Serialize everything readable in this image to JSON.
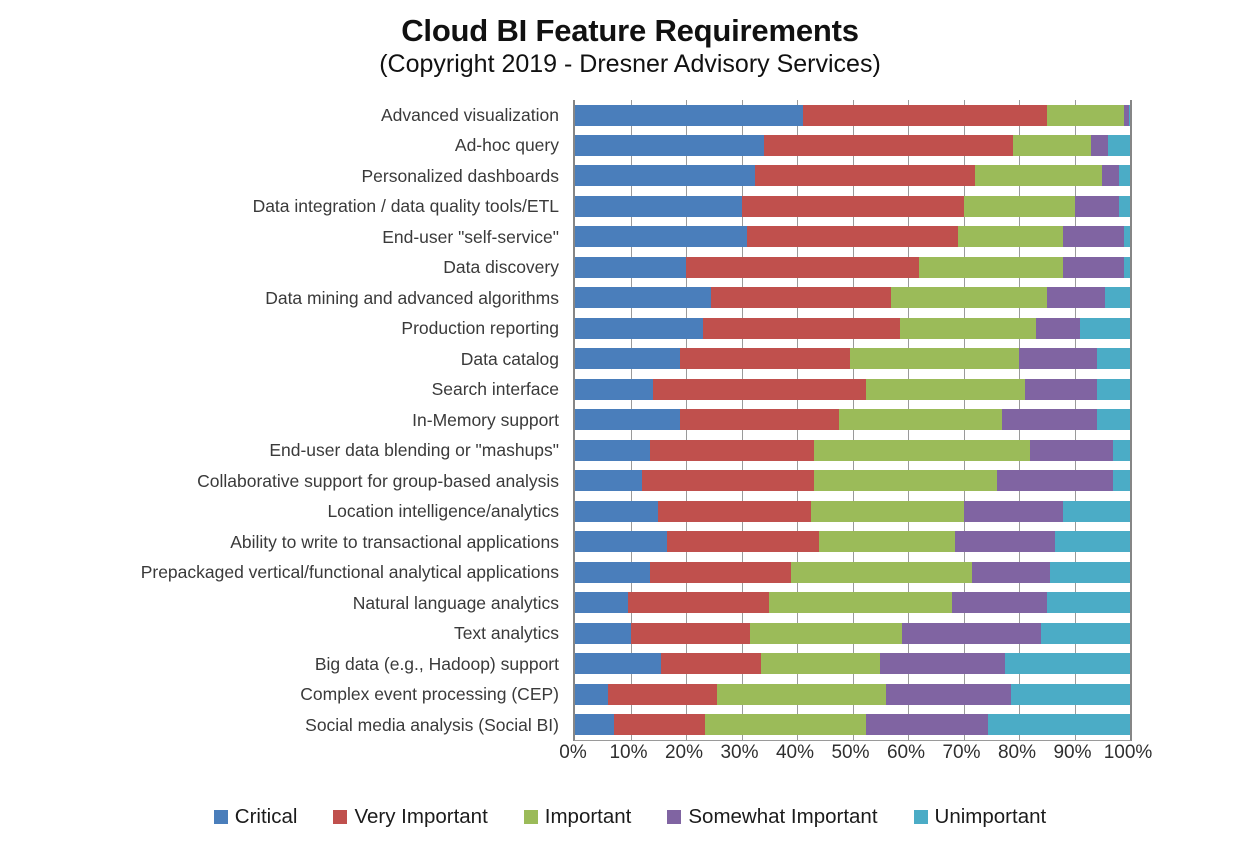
{
  "header": {
    "title": "Cloud BI Feature Requirements",
    "subtitle": "(Copyright 2019 - Dresner Advisory Services)"
  },
  "chart_data": {
    "type": "bar",
    "orientation": "horizontal",
    "stacked": true,
    "stack_mode": "percent",
    "title": "Cloud BI Feature Requirements",
    "subtitle": "(Copyright 2019 - Dresner Advisory Services)",
    "xlabel": "",
    "ylabel": "",
    "xlim": [
      0,
      100
    ],
    "xticks": [
      "0%",
      "10%",
      "20%",
      "30%",
      "40%",
      "50%",
      "60%",
      "70%",
      "80%",
      "90%",
      "100%"
    ],
    "xtick_values": [
      0,
      10,
      20,
      30,
      40,
      50,
      60,
      70,
      80,
      90,
      100
    ],
    "grid": true,
    "grid_axis": "x",
    "legend_position": "bottom",
    "categories": [
      "Advanced visualization",
      "Ad-hoc query",
      "Personalized dashboards",
      "Data integration / data quality tools/ETL",
      "End-user \"self-service\"",
      "Data discovery",
      "Data mining and advanced algorithms",
      "Production reporting",
      "Data catalog",
      "Search interface",
      "In-Memory support",
      "End-user data blending or \"mashups\"",
      "Collaborative support for group-based analysis",
      "Location intelligence/analytics",
      "Ability to write to transactional applications",
      "Prepackaged vertical/functional analytical applications",
      "Natural language analytics",
      "Text analytics",
      "Big data (e.g., Hadoop) support",
      "Complex event processing (CEP)",
      "Social media analysis (Social BI)"
    ],
    "series": [
      {
        "name": "Critical",
        "color": "#4A7EBB",
        "values": [
          41.0,
          34.0,
          32.5,
          30.0,
          31.0,
          20.0,
          24.5,
          23.0,
          19.0,
          14.0,
          19.0,
          13.5,
          12.0,
          15.0,
          16.5,
          13.5,
          9.5,
          10.0,
          15.5,
          6.0,
          7.0
        ]
      },
      {
        "name": "Very Important",
        "color": "#C0504D",
        "values": [
          44.0,
          45.0,
          39.5,
          40.0,
          38.0,
          42.0,
          32.5,
          35.5,
          30.5,
          38.5,
          28.5,
          29.5,
          31.0,
          27.5,
          27.5,
          25.5,
          25.5,
          21.5,
          18.0,
          19.5,
          16.5
        ]
      },
      {
        "name": "Important",
        "color": "#9BBB59",
        "values": [
          14.0,
          14.0,
          23.0,
          20.0,
          19.0,
          26.0,
          28.0,
          24.5,
          30.5,
          28.5,
          29.5,
          39.0,
          33.0,
          27.5,
          24.5,
          32.5,
          33.0,
          27.5,
          21.5,
          30.5,
          29.0
        ]
      },
      {
        "name": "Somewhat Important",
        "color": "#8064A2",
        "values": [
          0.8,
          3.0,
          3.0,
          8.0,
          11.0,
          11.0,
          10.5,
          8.0,
          14.0,
          13.0,
          17.0,
          15.0,
          21.0,
          18.0,
          18.0,
          14.0,
          17.0,
          25.0,
          22.5,
          22.5,
          22.0
        ]
      },
      {
        "name": "Unimportant",
        "color": "#4BACC6",
        "values": [
          0.2,
          4.0,
          2.0,
          2.0,
          1.0,
          1.0,
          4.5,
          9.0,
          6.0,
          6.0,
          6.0,
          3.0,
          3.0,
          12.0,
          13.5,
          14.5,
          15.0,
          16.0,
          22.5,
          21.5,
          25.5
        ]
      }
    ]
  },
  "legend": {
    "items": [
      {
        "label": "Critical",
        "color": "#4A7EBB"
      },
      {
        "label": "Very Important",
        "color": "#C0504D"
      },
      {
        "label": "Important",
        "color": "#9BBB59"
      },
      {
        "label": "Somewhat Important",
        "color": "#8064A2"
      },
      {
        "label": "Unimportant",
        "color": "#4BACC6"
      }
    ]
  }
}
